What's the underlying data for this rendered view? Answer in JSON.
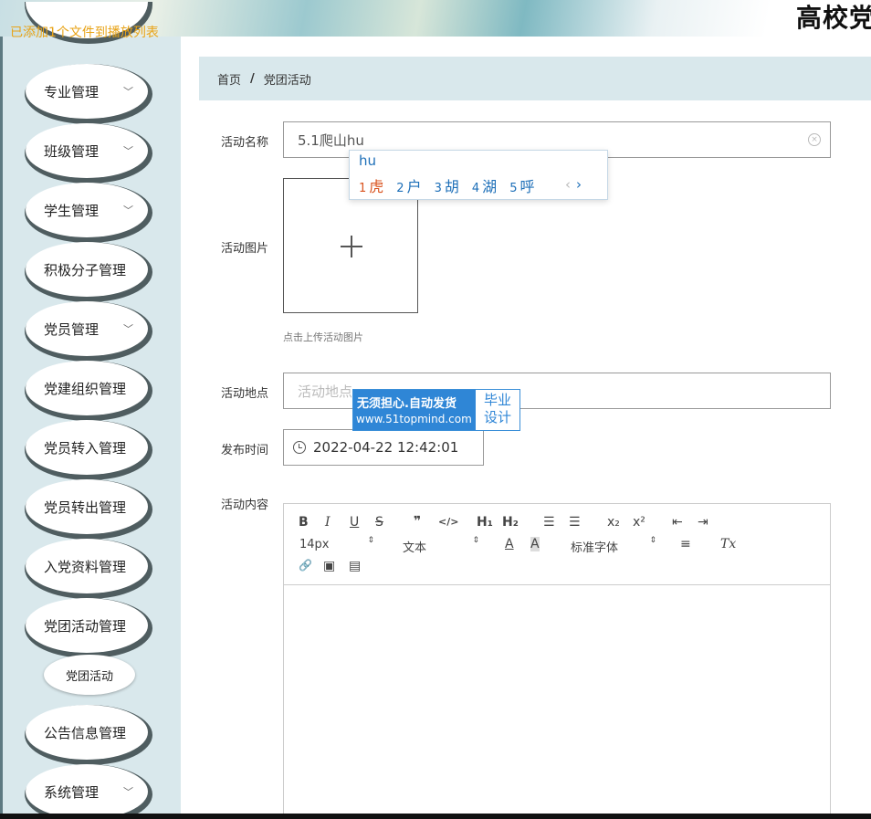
{
  "header": {
    "title": "高校党",
    "notice": "已添加1个文件到播放列表"
  },
  "sidebar": {
    "items": [
      {
        "label": "专业管理",
        "chevron": true
      },
      {
        "label": "班级管理",
        "chevron": true
      },
      {
        "label": "学生管理",
        "chevron": true
      },
      {
        "label": "积极分子管理",
        "chevron": false
      },
      {
        "label": "党员管理",
        "chevron": true
      },
      {
        "label": "党建组织管理",
        "chevron": false
      },
      {
        "label": "党员转入管理",
        "chevron": false
      },
      {
        "label": "党员转出管理",
        "chevron": false
      },
      {
        "label": "入党资料管理",
        "chevron": false
      },
      {
        "label": "党团活动管理",
        "chevron": false
      },
      {
        "label": "公告信息管理",
        "chevron": false
      },
      {
        "label": "系统管理",
        "chevron": true
      }
    ],
    "submenu": {
      "label": "党团活动"
    }
  },
  "breadcrumb": {
    "home": "首页",
    "sep": "/",
    "current": "党团活动"
  },
  "form": {
    "name_label": "活动名称",
    "name_value": "5.1爬山hu",
    "image_label": "活动图片",
    "image_hint": "点击上传活动图片",
    "location_label": "活动地点",
    "location_placeholder": "活动地点",
    "time_label": "发布时间",
    "time_value": "2022-04-22 12:42:01",
    "content_label": "活动内容"
  },
  "ime": {
    "pinyin": "hu",
    "candidates": [
      {
        "num": "1",
        "char": "虎"
      },
      {
        "num": "2",
        "char": "户"
      },
      {
        "num": "3",
        "char": "胡"
      },
      {
        "num": "4",
        "char": "湖"
      },
      {
        "num": "5",
        "char": "呼"
      }
    ],
    "prev": "‹",
    "next": "›"
  },
  "watermark": {
    "line1": "无须担心.自动发货",
    "line2": "www.51topmind.com",
    "side_top": "毕业",
    "side_bottom": "设计"
  },
  "editor": {
    "bold": "B",
    "italic": "I",
    "underline": "U",
    "strike": "S",
    "quote": "❞",
    "code": "</>",
    "h1": "H₁",
    "h2": "H₂",
    "ordered_list": "☰",
    "bullet_list": "☰",
    "subscript": "x₂",
    "superscript": "x²",
    "outdent": "⇤",
    "indent": "⇥",
    "size_value": "14px",
    "format_value": "文本",
    "font_color": "A",
    "bg_color": "A",
    "font_value": "标准字体",
    "align": "≡",
    "clear": "Tx",
    "link": "🔗",
    "image": "▣",
    "video": "▤",
    "select_arrow": "⇕"
  }
}
